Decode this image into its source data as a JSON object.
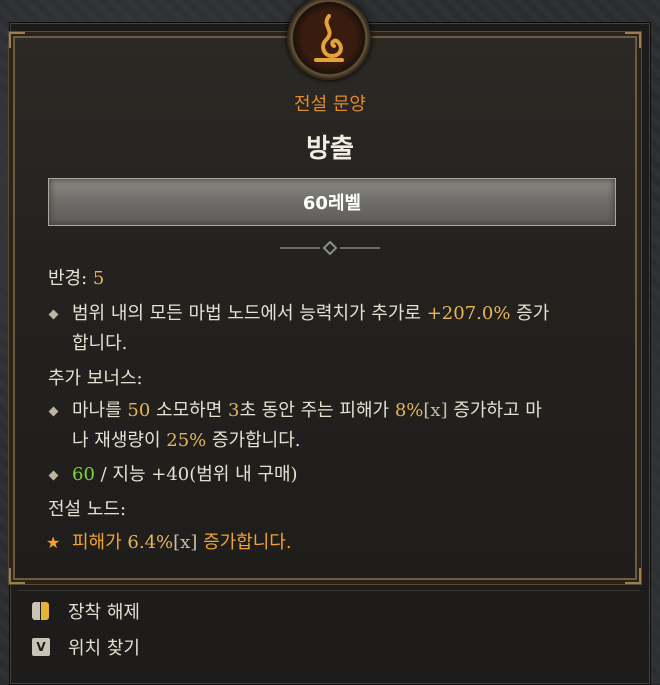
{
  "emblem": {
    "icon": "legendary-glyph-icon",
    "color": "#e6a13a"
  },
  "subtitle": "전설 문양",
  "title": "방출",
  "level_label": "60레벨",
  "radius": {
    "label": "반경:",
    "value": "5"
  },
  "bullet1": {
    "text_a": "범위 내의 모든 마법 노드에서 능력치가 추가로 ",
    "value": "+207.0%",
    "text_b": " 증가",
    "line2": "합니다."
  },
  "bonus": {
    "label": "추가 보너스:",
    "line1_a": "마나를 ",
    "line1_b": "50",
    "line1_c": " 소모하면 ",
    "line1_d": "3",
    "line1_e": "초 동안 주는 피해가 ",
    "line1_f": "8%",
    "line1_g": "[x]",
    "line1_h": " 증가하고 마",
    "line2_a": "나 재생량이 ",
    "line2_b": "25%",
    "line2_c": " 증가합니다.",
    "req_value": "60",
    "req_text": " / 지능 +40(범위 내 구매)"
  },
  "legendary_node": {
    "label": "전설 노드:",
    "text_a": "피해가 ",
    "value": "6.4%",
    "bracket": "[x]",
    "text_b": " 증가합니다."
  },
  "footer": [
    {
      "icon": "mouse-icon",
      "label": "장착 해제"
    },
    {
      "icon": "v-key-icon",
      "key": "V",
      "label": "위치 찾기"
    }
  ]
}
